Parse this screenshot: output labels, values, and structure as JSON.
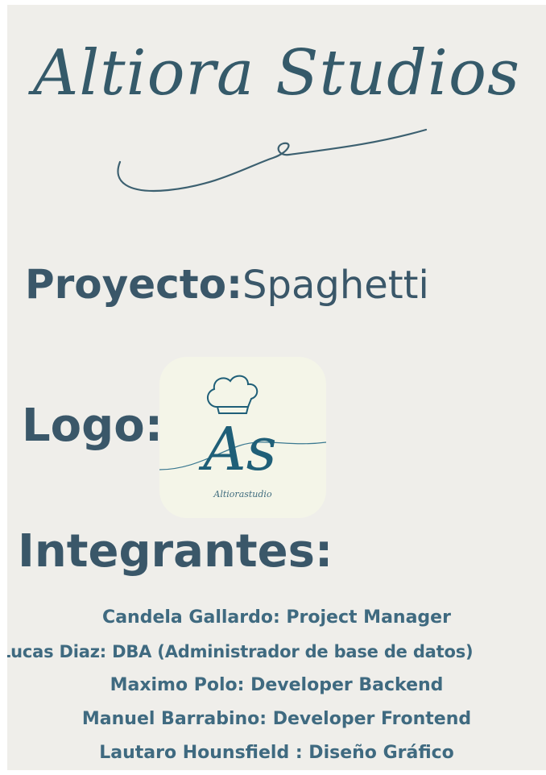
{
  "brand": {
    "title": "Altiora Studios"
  },
  "project": {
    "label": "Proyecto:",
    "value": "Spaghetti"
  },
  "logo": {
    "label": "Logo:",
    "monogram": "As",
    "caption": "Altiorastudio",
    "icon": "chef-hat-icon",
    "colors": {
      "background": "#f4f5e8",
      "ink": "#1f5f78"
    }
  },
  "members": {
    "title": "Integrantes:",
    "items": [
      "Candela Gallardo: Project Manager",
      "Lucas Diaz: DBA (Administrador de base de datos)",
      "Maximo Polo: Developer Backend",
      "Manuel Barrabino: Developer Frontend",
      "Lautaro Hounsfield : Diseño Gráfico"
    ]
  },
  "colors": {
    "page_background": "#efeeea",
    "heading": "#3a5769",
    "text": "#3f6a80"
  }
}
